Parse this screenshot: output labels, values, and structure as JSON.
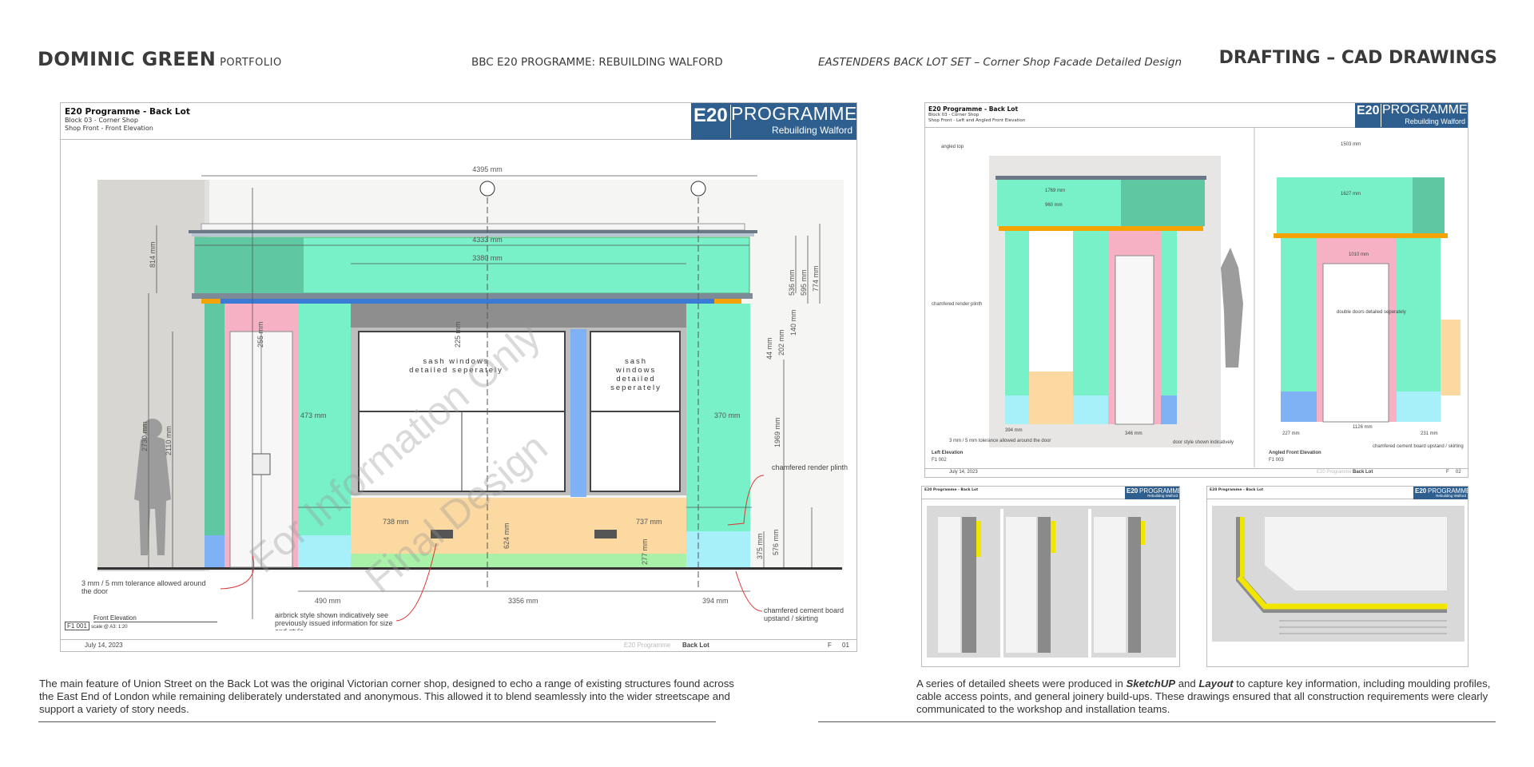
{
  "header": {
    "brand": "DOMINIC GREEN",
    "brand_sub": "PORTFOLIO",
    "programme": "BBC E20 PROGRAMME: REBUILDING WALFORD",
    "project": "EASTENDERS BACK LOT SET – Corner Shop Facade Detailed Design",
    "section": "DRAFTING – CAD DRAWINGS"
  },
  "main_sheet": {
    "title": "E20 Programme - Back Lot",
    "block": "Block 03 - Corner Shop",
    "view": "Shop Front - Front Elevation",
    "logo_main": "E20",
    "logo_word": "PROGRAMME",
    "logo_sub": "Rebuilding Walford",
    "watermark_1": "For Information Only",
    "watermark_2": "Final Design",
    "dims": {
      "overall": "4395 mm",
      "facia": "4333 mm",
      "window_top": "3380 mm",
      "h814": "814 mm",
      "h2730": "2730 mm",
      "h2110": "2110 mm",
      "h255": "255 mm",
      "h225": "225 mm",
      "w473": "473 mm",
      "w370": "370 mm",
      "h536": "536 mm",
      "h595": "595 mm",
      "h774": "774 mm",
      "h44": "44 mm",
      "h202": "202 mm",
      "h140": "140 mm",
      "h1969": "1969 mm",
      "w738": "738 mm",
      "w737": "737 mm",
      "h624": "624 mm",
      "h277": "277 mm",
      "h375": "375 mm",
      "h576": "576 mm",
      "w490": "490 mm",
      "w3356": "3356 mm",
      "w394": "394 mm"
    },
    "notes": {
      "sash_left": "sash windows detailed seperately",
      "sash_right": "sash windows detailed seperately",
      "plinth": "chamfered render plinth",
      "tolerance": "3 mm / 5 mm tolerance allowed around the door",
      "airbrick": "airbrick style shown indicatively see previously issued information for size and style.",
      "skirting": "chamfered cement board upstand / skirting"
    },
    "drawing_title": "Front Elevation",
    "ref": "F1 001",
    "scale": "scale @ A3: 1:20",
    "date": "July 14, 2023",
    "footer_prog": "E20 Programme",
    "footer_area": "Back Lot",
    "sheet_letter": "F",
    "sheet_num": "01"
  },
  "side_sheet": {
    "title": "E20 Programme - Back Lot",
    "block": "Block 03 - Corner Shop",
    "view": "Shop Front - Left and Angled Front Elevation",
    "logo_main": "E20",
    "logo_word": "PROGRAMME",
    "logo_sub": "Rebuilding Walford",
    "notes": {
      "angled_top": "angled top",
      "plinth": "chamfered render plinth",
      "tolerance": "3 mm / 5 mm tolerance allowed around the door",
      "door_style": "door style shown indicatively",
      "double_doors": "double doors detailed seperately",
      "board": "chamfered cement board upstand / skirting"
    },
    "dims": {
      "d1769": "1769 mm",
      "d960": "960 mm",
      "d1503": "1503 mm",
      "d1627": "1627 mm",
      "d1010": "1010 mm",
      "d394": "394 mm",
      "d346": "346 mm",
      "d1126": "1126 mm",
      "d227": "227 mm",
      "d231": "231 mm"
    },
    "left_title": "Left Elevation",
    "left_ref": "F1 002",
    "right_title": "Angled Front Elevation",
    "right_ref": "F1 003",
    "date": "July 14, 2023",
    "footer_prog": "E20 Programme",
    "footer_area": "Back Lot",
    "sheet_letter": "F",
    "sheet_num": "02"
  },
  "section_sheets": {
    "left_title": "E20 Programme - Back Lot",
    "right_title": "E20 Programme - Back Lot",
    "logo_main": "E20",
    "logo_word": "PROGRAMME",
    "logo_sub": "Rebuilding Walford"
  },
  "captions": {
    "left": "The main feature of Union Street on the Back Lot was the original Victorian corner shop, designed to echo a range of existing structures found across the East End of London while remaining deliberately understated and anonymous. This allowed it to blend seamlessly into the wider streetscape and support a variety of story needs.",
    "right_1": "A series of detailed sheets were produced in ",
    "right_sketchup": "SketchUP",
    "right_and": " and ",
    "right_layout": "Layout",
    "right_2": " to capture key information, including moulding profiles, cable access points, and general joinery build-ups. These drawings ensured that all construction requirements were clearly communicated to the workshop and installation teams."
  },
  "colors": {
    "mint": "#78f0c8",
    "mint_dark": "#5fc8a2",
    "pink": "#f6b2c4",
    "peach": "#fcd9a1",
    "cyan": "#a7f0fa",
    "blue": "#7fb2f4",
    "logo_blue": "#2f5f8e",
    "wall_grey": "#d7d6d3",
    "yellow": "#f2e600"
  }
}
